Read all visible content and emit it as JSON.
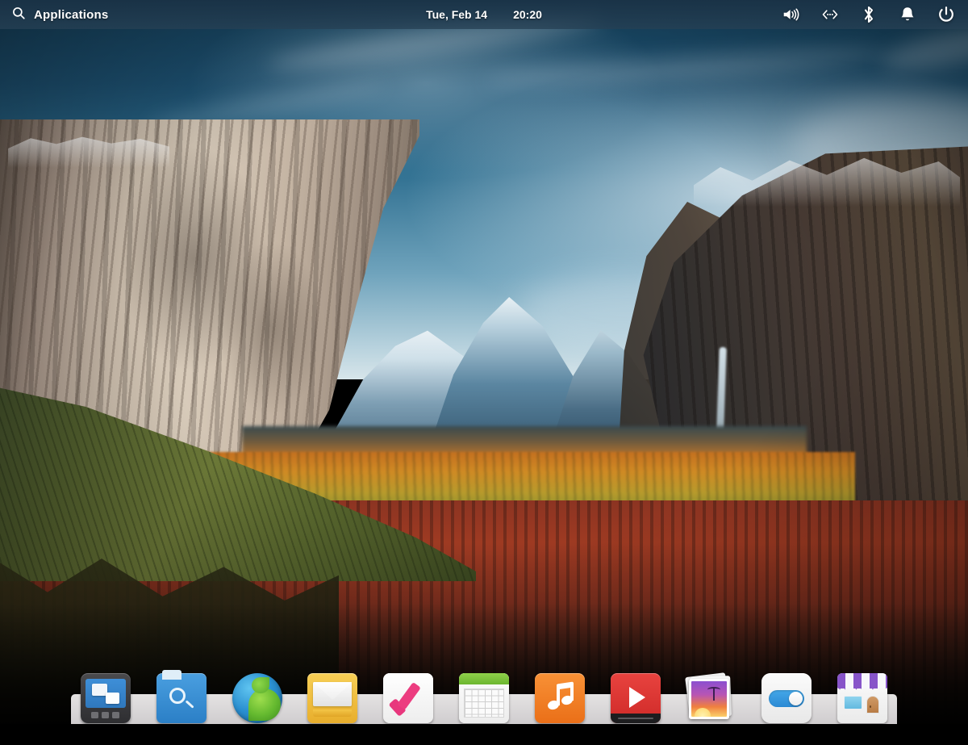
{
  "panel": {
    "search_icon": "search-icon",
    "applications_label": "Applications",
    "clock": {
      "date": "Tue, Feb 14",
      "time": "20:20"
    },
    "tray": [
      {
        "name": "volume-icon",
        "label": "Sound"
      },
      {
        "name": "network-icon",
        "label": "Network"
      },
      {
        "name": "bluetooth-icon",
        "label": "Bluetooth"
      },
      {
        "name": "notification-icon",
        "label": "Notifications"
      },
      {
        "name": "power-icon",
        "label": "System"
      }
    ],
    "background_color": "#26404f",
    "text_color": "#ffffff"
  },
  "dock": {
    "background_color": "#e4e1e2",
    "items": [
      {
        "name": "dock-item-multitasking-view",
        "label": "Multitasking View",
        "icon": "multitasking-view-icon"
      },
      {
        "name": "dock-item-files",
        "label": "Files",
        "icon": "files-icon"
      },
      {
        "name": "dock-item-web",
        "label": "Web",
        "icon": "globe-icon"
      },
      {
        "name": "dock-item-mail",
        "label": "Mail",
        "icon": "mail-icon"
      },
      {
        "name": "dock-item-tasks",
        "label": "Tasks",
        "icon": "checkmark-icon"
      },
      {
        "name": "dock-item-calendar",
        "label": "Calendar",
        "icon": "calendar-icon"
      },
      {
        "name": "dock-item-music",
        "label": "Music",
        "icon": "music-note-icon"
      },
      {
        "name": "dock-item-videos",
        "label": "Videos",
        "icon": "play-icon"
      },
      {
        "name": "dock-item-photos",
        "label": "Photos",
        "icon": "photos-icon"
      },
      {
        "name": "dock-item-settings",
        "label": "System Settings",
        "icon": "toggle-icon"
      },
      {
        "name": "dock-item-appcenter",
        "label": "AppCenter",
        "icon": "storefront-icon"
      }
    ]
  },
  "wallpaper": {
    "name": "Yosemite Valley",
    "sky_top_color": "#16435f",
    "sky_bottom_color": "#d7e5ea",
    "granite_color": "#d8cbba",
    "foliage_color": "#9e3a22"
  }
}
